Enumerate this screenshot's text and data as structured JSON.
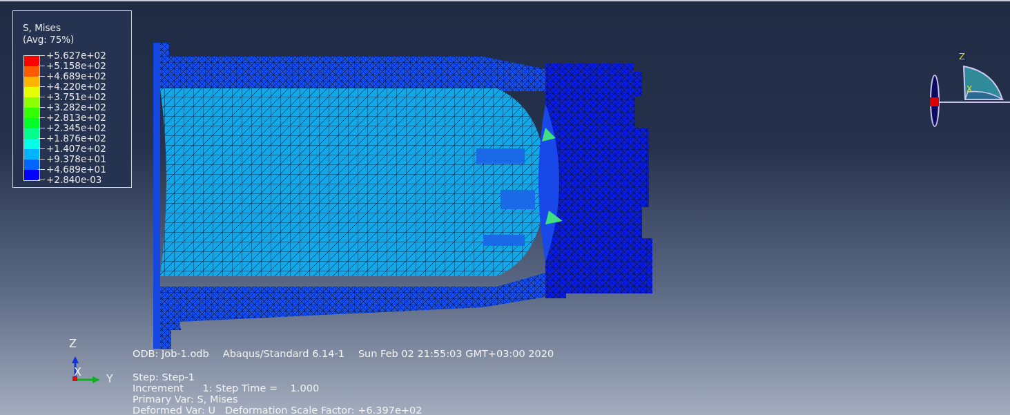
{
  "legend": {
    "title": "S, Mises",
    "subtitle": "(Avg: 75%)",
    "bands": [
      {
        "color": "#ff0000"
      },
      {
        "color": "#ff5a00"
      },
      {
        "color": "#ffb400"
      },
      {
        "color": "#e6ff00"
      },
      {
        "color": "#8cff00"
      },
      {
        "color": "#32ff00"
      },
      {
        "color": "#00ff28"
      },
      {
        "color": "#00ff8c"
      },
      {
        "color": "#00ffe6"
      },
      {
        "color": "#00b4ff"
      },
      {
        "color": "#0064ff"
      },
      {
        "color": "#0000ff"
      }
    ],
    "ticks": [
      "+5.627e+02",
      "+5.158e+02",
      "+4.689e+02",
      "+4.220e+02",
      "+3.751e+02",
      "+3.282e+02",
      "+2.813e+02",
      "+2.345e+02",
      "+1.876e+02",
      "+1.407e+02",
      "+9.378e+01",
      "+4.689e+01",
      "+2.840e-03"
    ]
  },
  "view_gizmo": {
    "labels": [
      "Z",
      "X"
    ]
  },
  "triad": {
    "labels": [
      "Z",
      "X",
      "Y"
    ]
  },
  "info": {
    "header": [
      "ODB: Job-1.odb",
      "Abaqus/Standard 6.14-1",
      "Sun Feb 02 21:55:03 GMT+03:00 2020"
    ],
    "lines": [
      "Step: Step-1",
      "Increment      1: Step Time =    1.000",
      "Primary Var: S, Mises",
      "Deformed Var: U   Deformation Scale Factor: +6.397e+02"
    ]
  }
}
